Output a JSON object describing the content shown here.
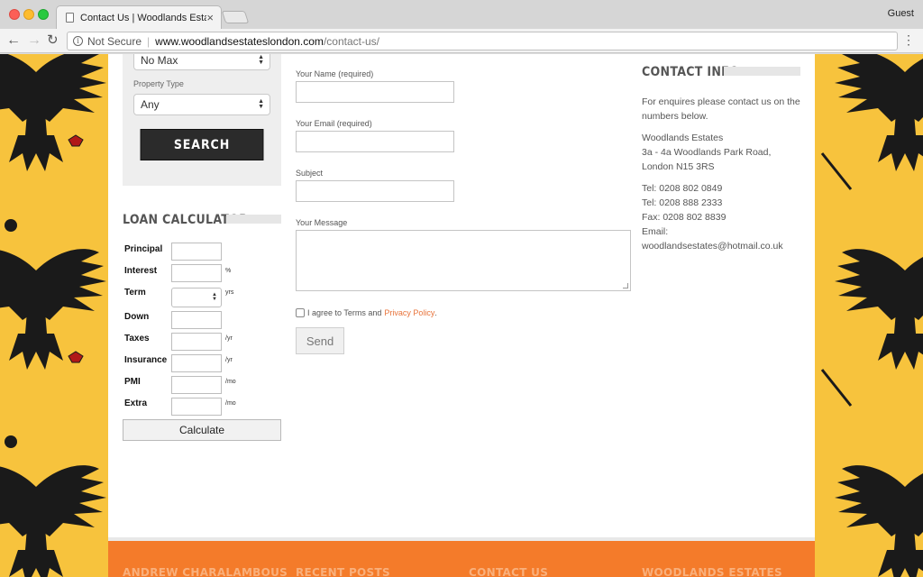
{
  "browser": {
    "tab_title": "Contact Us | Woodlands Estates",
    "tab_close": "×",
    "profile": "Guest",
    "security": "Not Secure",
    "url_host": "www.woodlandsestateslondon.com",
    "url_path": "/contact-us/",
    "nav_back": "←",
    "nav_forward": "→",
    "nav_reload": "C",
    "menu": "⋮"
  },
  "search": {
    "max_price_value": "No Max",
    "property_type_label": "Property Type",
    "property_type_value": "Any",
    "search_button": "SEARCH"
  },
  "loan_calculator": {
    "title": "LOAN CALCULATOR",
    "fields": [
      {
        "label": "Principal",
        "unit": ""
      },
      {
        "label": "Interest",
        "unit": "%"
      },
      {
        "label": "Term",
        "unit": "yrs"
      },
      {
        "label": "Down",
        "unit": ""
      },
      {
        "label": "Taxes",
        "unit": "/yr"
      },
      {
        "label": "Insurance",
        "unit": "/yr"
      },
      {
        "label": "PMI",
        "unit": "/mo"
      },
      {
        "label": "Extra",
        "unit": "/mo"
      }
    ],
    "calculate_button": "Calculate"
  },
  "contact_form": {
    "name_label": "Your Name (required)",
    "email_label": "Your Email (required)",
    "subject_label": "Subject",
    "message_label": "Your Message",
    "agree_text": "I agree to Terms and",
    "privacy_link": "Privacy Policy",
    "agree_suffix": ".",
    "send_button": "Send"
  },
  "contact_info": {
    "title": "CONTACT INFO",
    "intro": "For enquires please contact us on the numbers below.",
    "company": "Woodlands Estates",
    "address1": "3a - 4a Woodlands Park Road,",
    "address2": "London N15 3RS",
    "tel1": "Tel: 0208 802 0849",
    "tel2": "Tel: 0208 888 2333",
    "fax": "Fax: 0208 802 8839",
    "email_label": "Email:",
    "email": "woodlandsestates@hotmail.co.uk"
  },
  "footer": {
    "headings": [
      "ANDREW CHARALAMBOUS",
      "RECENT POSTS",
      "CONTACT US",
      "WOODLANDS ESTATES"
    ]
  },
  "colors": {
    "background_yellow": "#f7c33d",
    "footer_orange": "#f47b2a",
    "link_orange": "#e8733a",
    "search_button": "#2b2b2b"
  }
}
